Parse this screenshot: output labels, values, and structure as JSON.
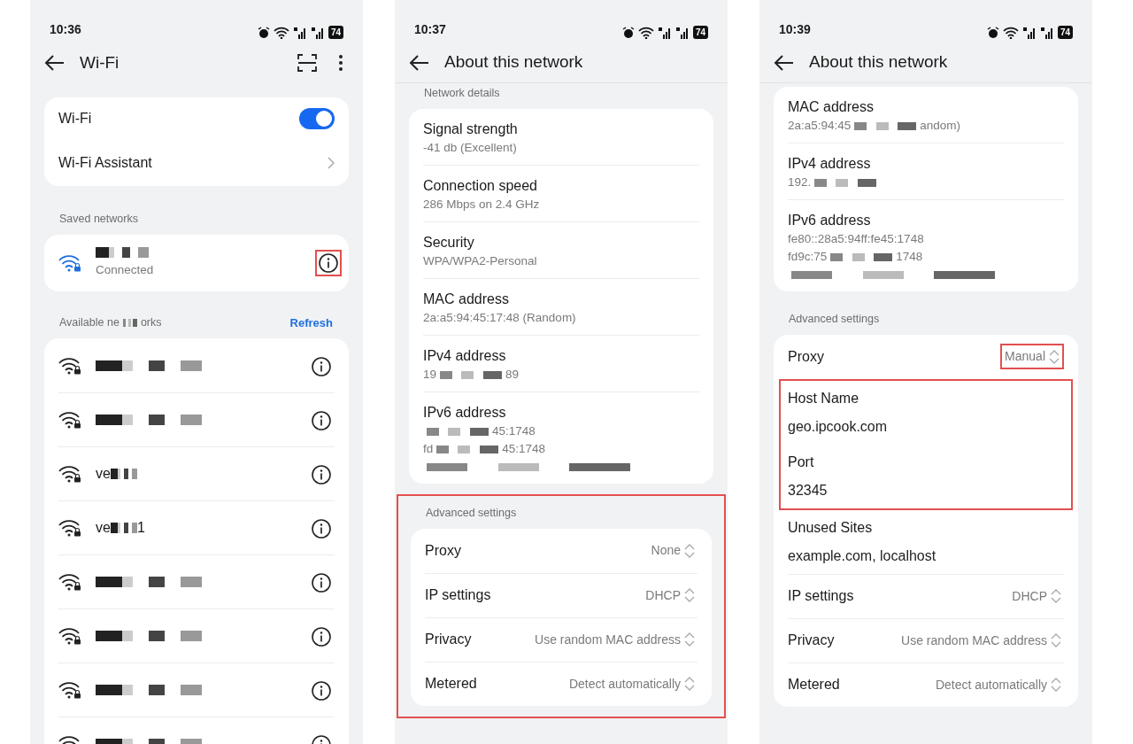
{
  "phones": [
    {
      "kind": "wifi_list",
      "status": {
        "time": "10:36",
        "battery": "74"
      },
      "title": "Wi-Fi",
      "toggle_row": {
        "label": "Wi-Fi",
        "on": true
      },
      "assistant_row": {
        "label": "Wi-Fi Assistant"
      },
      "saved_header": "Saved networks",
      "saved_network": {
        "status": "Connected",
        "connected": true,
        "info_highlighted": true
      },
      "available_header": {
        "before": "Available ne",
        "after": "orks"
      },
      "refresh": "Refresh",
      "networks": [
        {
          "redacted": true
        },
        {
          "redacted": true
        },
        {
          "before": "ve",
          "redacted": true
        },
        {
          "before": "ve",
          "after": "1",
          "redacted": true
        },
        {
          "redacted": true
        },
        {
          "redacted": true
        },
        {
          "redacted": true
        },
        {
          "redacted": true
        }
      ]
    },
    {
      "kind": "details",
      "status": {
        "time": "10:37",
        "battery": "74"
      },
      "title": "About this network",
      "sections": [
        {
          "header": "Network details",
          "highlighted": false,
          "rows": [
            {
              "kind": "detail",
              "label": "Signal strength",
              "lines": [
                {
                  "before": "-41 db (Excellent)",
                  "redacted": false
                }
              ]
            },
            {
              "kind": "detail",
              "label": "Connection speed",
              "lines": [
                {
                  "before": "286 Mbps on 2.4 GHz",
                  "redacted": false
                }
              ]
            },
            {
              "kind": "detail",
              "label": "Security",
              "lines": [
                {
                  "before": "WPA/WPA2-Personal",
                  "redacted": false
                }
              ]
            },
            {
              "kind": "detail",
              "label": "MAC address",
              "lines": [
                {
                  "before": "2a:a5:94:45:17:48 (Random)",
                  "redacted": false
                }
              ]
            },
            {
              "kind": "detail",
              "label": "IPv4 address",
              "lines": [
                {
                  "before": "19",
                  "after": "89",
                  "redacted": true
                }
              ]
            },
            {
              "kind": "detail",
              "label": "IPv6 address",
              "lines": [
                {
                  "after": "45:1748",
                  "redacted": true
                },
                {
                  "before": "fd",
                  "after": "45:1748",
                  "redacted": true
                },
                {
                  "redacted": true
                }
              ]
            }
          ]
        },
        {
          "header": "Advanced settings",
          "highlighted": true,
          "rows": [
            {
              "kind": "select",
              "label": "Proxy",
              "value": "None",
              "value_highlighted": false
            },
            {
              "kind": "select",
              "label": "IP settings",
              "value": "DHCP",
              "value_highlighted": false
            },
            {
              "kind": "select",
              "label": "Privacy",
              "value": "Use random MAC address",
              "value_highlighted": false
            },
            {
              "kind": "select",
              "label": "Metered",
              "value": "Detect automatically",
              "value_highlighted": false
            }
          ]
        }
      ]
    },
    {
      "kind": "details",
      "status": {
        "time": "10:39",
        "battery": "74"
      },
      "title": "About this network",
      "sections": [
        {
          "highlighted": false,
          "rows": [
            {
              "kind": "detail",
              "label": "MAC address",
              "lines": [
                {
                  "before": "2a:a5:94:45",
                  "after": "andom)",
                  "redacted": true
                }
              ]
            },
            {
              "kind": "detail",
              "label": "IPv4 address",
              "lines": [
                {
                  "before": "192.",
                  "redacted": true
                }
              ]
            },
            {
              "kind": "detail",
              "label": "IPv6 address",
              "lines": [
                {
                  "before": "fe80::28a5:94ff:fe45:1748",
                  "redacted": false
                },
                {
                  "before": "fd9c:75",
                  "after": "1748",
                  "redacted": true
                },
                {
                  "redacted": true
                }
              ]
            }
          ]
        },
        {
          "header": "Advanced settings",
          "highlighted": false,
          "rows": [
            {
              "kind": "select",
              "label": "Proxy",
              "value": "Manual",
              "value_highlighted": true
            },
            {
              "kind": "group",
              "highlighted": true,
              "rows": [
                {
                  "kind": "field",
                  "label": "Host Name",
                  "value": "geo.ipcook.com"
                },
                {
                  "kind": "field",
                  "label": "Port",
                  "value": "32345"
                }
              ]
            },
            {
              "kind": "field",
              "label": "Unused Sites",
              "value": "example.com, localhost"
            },
            {
              "kind": "select",
              "label": "IP settings",
              "value": "DHCP",
              "value_highlighted": false
            },
            {
              "kind": "select",
              "label": "Privacy",
              "value": "Use random MAC address",
              "value_highlighted": false
            },
            {
              "kind": "select",
              "label": "Metered",
              "value": "Detect automatically",
              "value_highlighted": false
            }
          ]
        }
      ]
    }
  ]
}
